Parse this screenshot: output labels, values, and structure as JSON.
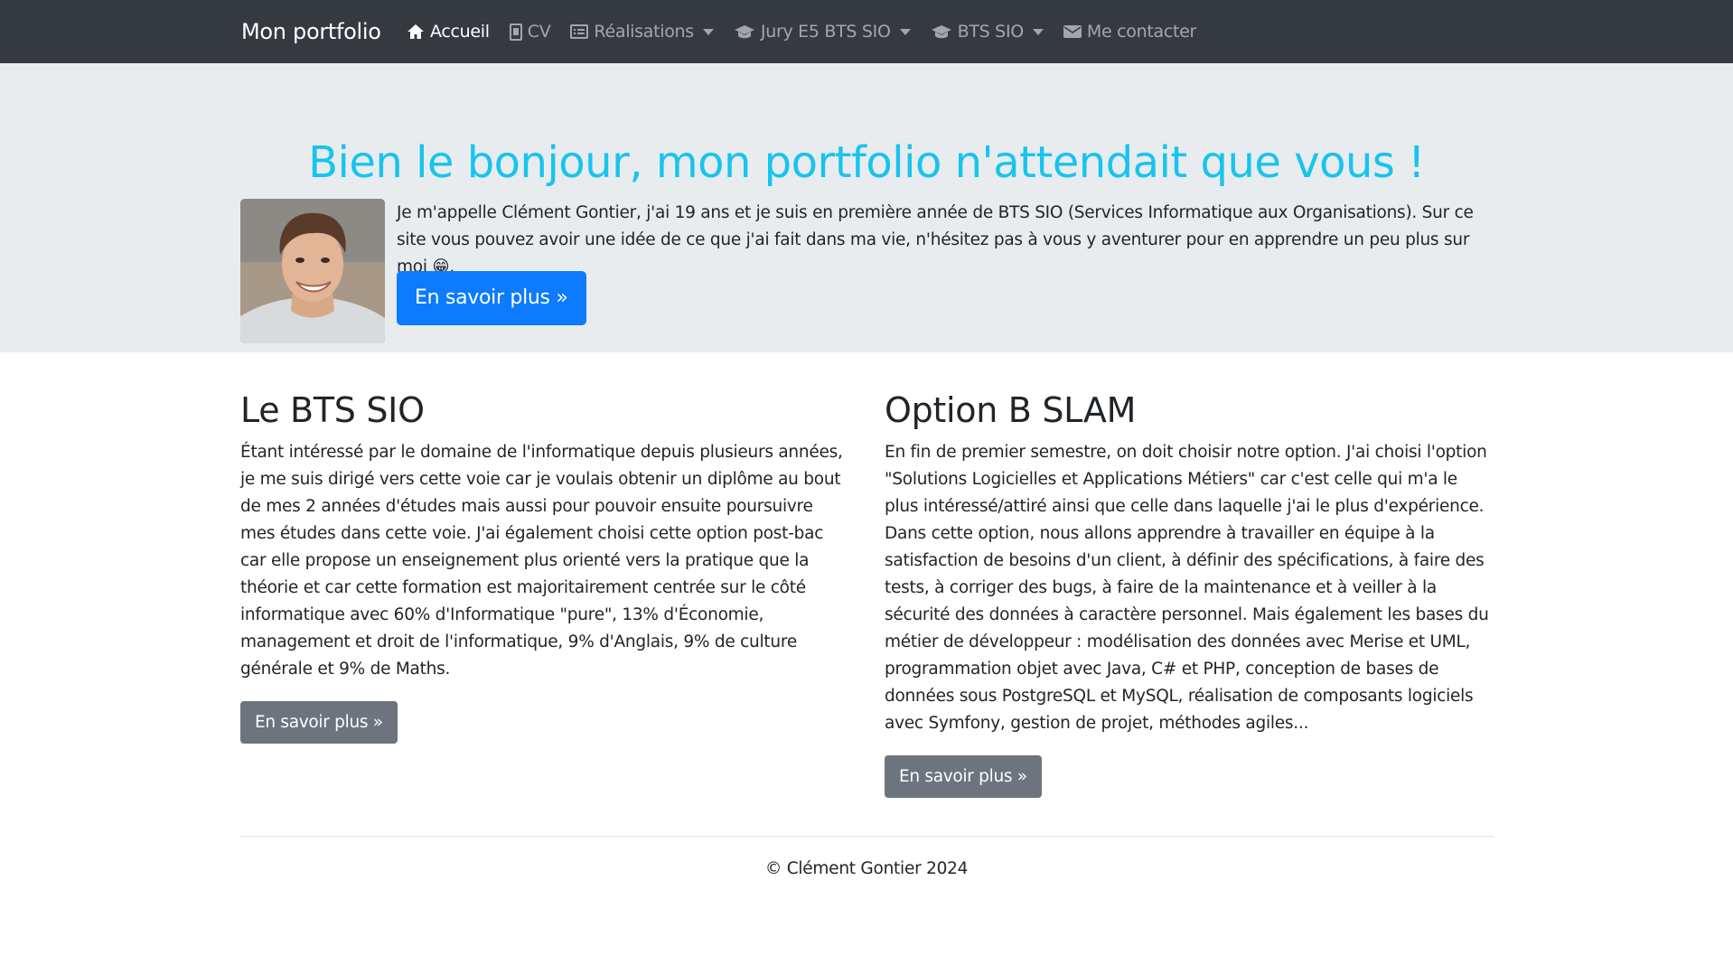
{
  "navbar": {
    "brand": "Mon portfolio",
    "items": [
      {
        "label": "Accueil",
        "icon": "home-icon",
        "active": true,
        "dropdown": false
      },
      {
        "label": "CV",
        "icon": "file-icon",
        "active": false,
        "dropdown": false
      },
      {
        "label": "Réalisations",
        "icon": "list-icon",
        "active": false,
        "dropdown": true
      },
      {
        "label": "Jury E5 BTS SIO",
        "icon": "graduation-cap-icon",
        "active": false,
        "dropdown": true
      },
      {
        "label": "BTS SIO",
        "icon": "graduation-cap-icon",
        "active": false,
        "dropdown": true
      },
      {
        "label": "Me contacter",
        "icon": "envelope-icon",
        "active": false,
        "dropdown": false
      }
    ]
  },
  "hero": {
    "title": "Bien le bonjour, mon portfolio n'attendait que vous !",
    "intro": "Je m'appelle Clément Gontier, j'ai 19 ans et je suis en première année de BTS SIO (Services Informatique aux Organisations). Sur ce site vous pouvez avoir une idée de ce que j'ai fait dans ma vie, n'hésitez pas à vous y aventurer pour en apprendre un peu plus sur moi 😁.",
    "button": "En savoir plus »"
  },
  "columns": [
    {
      "title": "Le BTS SIO",
      "text": "Étant intéressé par le domaine de l'informatique depuis plusieurs années, je me suis dirigé vers cette voie car je voulais obtenir un diplôme au bout de mes 2 années d'études mais aussi pour pouvoir ensuite poursuivre mes études dans cette voie. J'ai également choisi cette option post-bac car elle propose un enseignement plus orienté vers la pratique que la théorie et car cette formation est majoritairement centrée sur le côté informatique avec 60% d'Informatique \"pure\", 13% d'Économie, management et droit de l'informatique, 9% d'Anglais, 9% de culture générale et 9% de Maths.",
      "button": "En savoir plus »"
    },
    {
      "title": "Option B SLAM",
      "text": "En fin de premier semestre, on doit choisir notre option. J'ai choisi l'option \"Solutions Logicielles et Applications Métiers\" car c'est celle qui m'a le plus intéressé/attiré ainsi que celle dans laquelle j'ai le plus d'expérience. Dans cette option, nous allons apprendre à travailler en équipe à la satisfaction de besoins d'un client, à définir des spécifications, à faire des tests, à corriger des bugs, à faire de la maintenance et à veiller à la sécurité des données à caractère personnel. Mais également les bases du métier de développeur : modélisation des données avec Merise et UML, programmation objet avec Java, C# et PHP, conception de bases de données sous PostgreSQL et MySQL, réalisation de composants logiciels avec Symfony, gestion de projet, méthodes agiles...",
      "button": "En savoir plus »"
    }
  ],
  "footer": {
    "text": "© Clément Gontier 2024"
  },
  "colors": {
    "navbar": "#343a40",
    "hero_bg": "#e9ecef",
    "hero_title": "#17c4ee",
    "primary": "#0d7bfd",
    "secondary": "#6c757d"
  }
}
